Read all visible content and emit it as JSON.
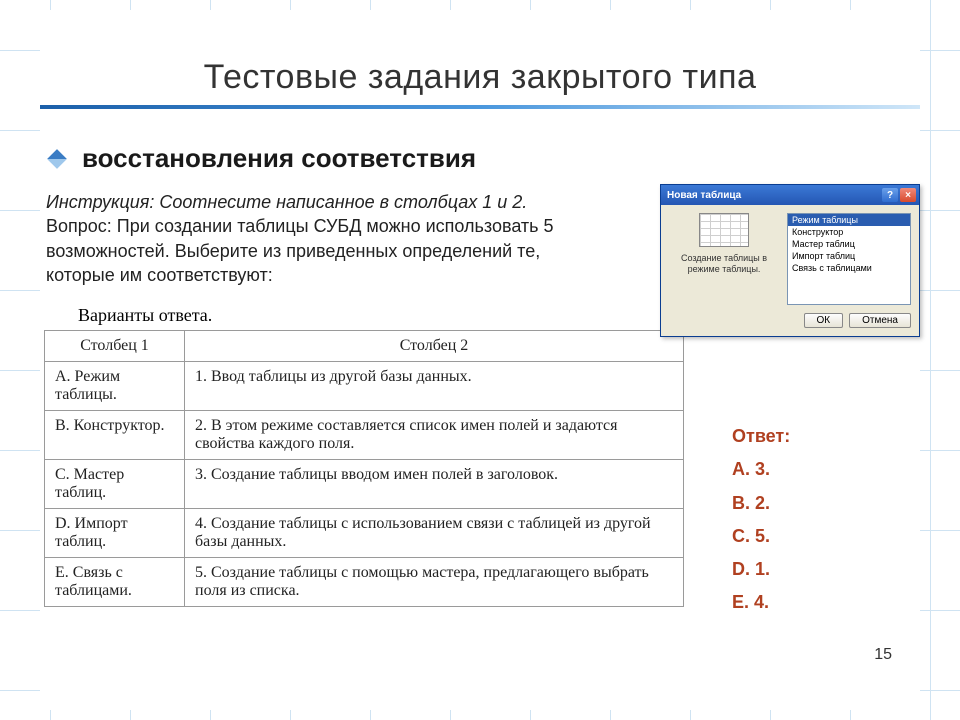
{
  "title": "Тестовые задания закрытого типа",
  "subtitle": "восстановления соответствия",
  "instruction": "Инструкция: Соотнесите написанное в столбцах 1 и 2.",
  "question": "Вопрос: При создании таблицы СУБД можно использовать 5 возможностей. Выберите из приведенных определений те, которые им соответствуют:",
  "variants_caption": "Варианты ответа.",
  "table": {
    "head": {
      "c1": "Столбец 1",
      "c2": "Столбец 2"
    },
    "rows": [
      {
        "c1": "A. Режим таблицы.",
        "c2": "1. Ввод таблицы из другой базы данных."
      },
      {
        "c1": "B. Конструктор.",
        "c2": "2. В этом режиме составляется список имен полей и задаются свойства каждого поля."
      },
      {
        "c1": "C. Мастер таблиц.",
        "c2": "3. Создание таблицы вводом имен полей в заголовок."
      },
      {
        "c1": "D. Импорт таблиц.",
        "c2": "4. Создание таблицы с использованием связи с таблицей из другой базы данных."
      },
      {
        "c1": "E. Связь с таблицами.",
        "c2": "5. Создание таблицы с помощью мастера, предлагающего выбрать поля из списка."
      }
    ]
  },
  "dialog": {
    "title": "Новая таблица",
    "preview_text": "Создание таблицы в режиме таблицы.",
    "list": [
      "Режим таблицы",
      "Конструктор",
      "Мастер таблиц",
      "Импорт таблиц",
      "Связь с таблицами"
    ],
    "ok": "ОК",
    "cancel": "Отмена"
  },
  "answer": {
    "caption": "Ответ:",
    "items": [
      "A. 3.",
      "B. 2.",
      "C. 5.",
      "D. 1.",
      "E. 4."
    ]
  },
  "page_number": "15"
}
